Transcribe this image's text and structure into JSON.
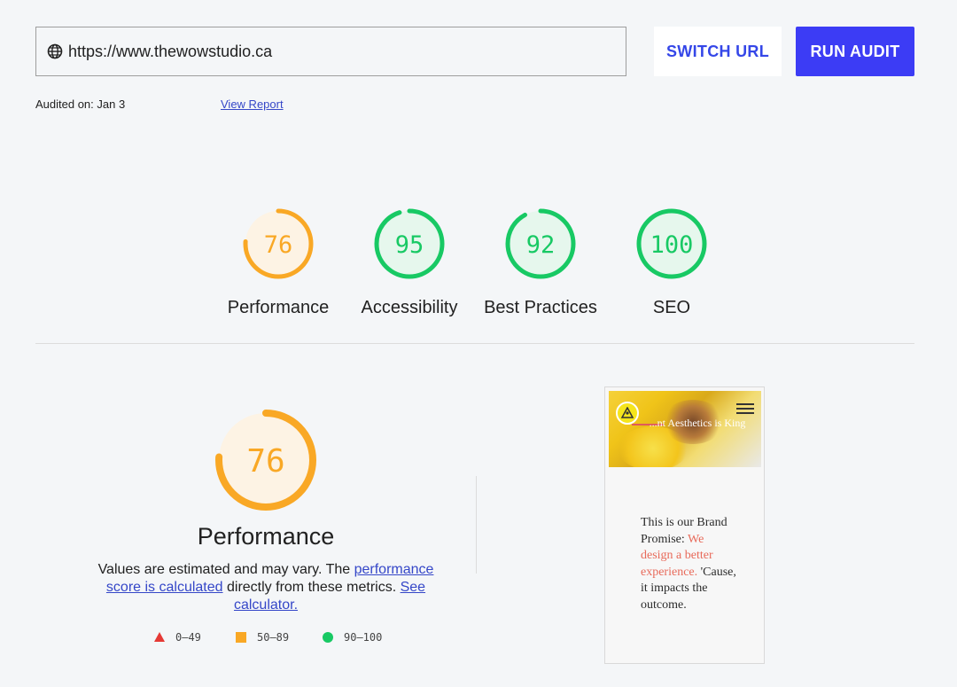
{
  "toolbar": {
    "url_value": "https://www.thewowstudio.ca",
    "switch_url_label": "SWITCH URL",
    "run_audit_label": "RUN AUDIT"
  },
  "meta": {
    "audited_on": "Audited on: Jan 3",
    "view_report_label": "View Report"
  },
  "scores": [
    {
      "label": "Performance",
      "value": "76",
      "score": 76,
      "status": "average"
    },
    {
      "label": "Accessibility",
      "value": "95",
      "score": 95,
      "status": "pass"
    },
    {
      "label": "Best Practices",
      "value": "92",
      "score": 92,
      "status": "pass"
    },
    {
      "label": "SEO",
      "value": "100",
      "score": 100,
      "status": "pass"
    }
  ],
  "performance": {
    "value": "76",
    "score": 76,
    "title": "Performance",
    "desc_pre": "Values are estimated and may vary. The ",
    "desc_link1": "performance score is calculated",
    "desc_mid": " directly from these metrics. ",
    "desc_link2": "See calculator."
  },
  "legend": [
    {
      "range": "0–49",
      "shape": "triangle",
      "color": "#e53935"
    },
    {
      "range": "50–89",
      "shape": "square",
      "color": "#f9a825"
    },
    {
      "range": "90–100",
      "shape": "circle",
      "color": "#18c964"
    }
  ],
  "thumbnail": {
    "hero_text": "...nt Aesthetics is King",
    "body_pre": "This is our Brand Promise: ",
    "body_accent": "We design a better experience.",
    "body_post": " 'Cause, it impacts the outcome."
  },
  "colors": {
    "average": "#f9a825",
    "average_bg": "#fdf3e4",
    "pass": "#18c964",
    "pass_bg": "#e6f7ed",
    "accent_button": "#3c3cf5",
    "link": "#3547c8"
  }
}
